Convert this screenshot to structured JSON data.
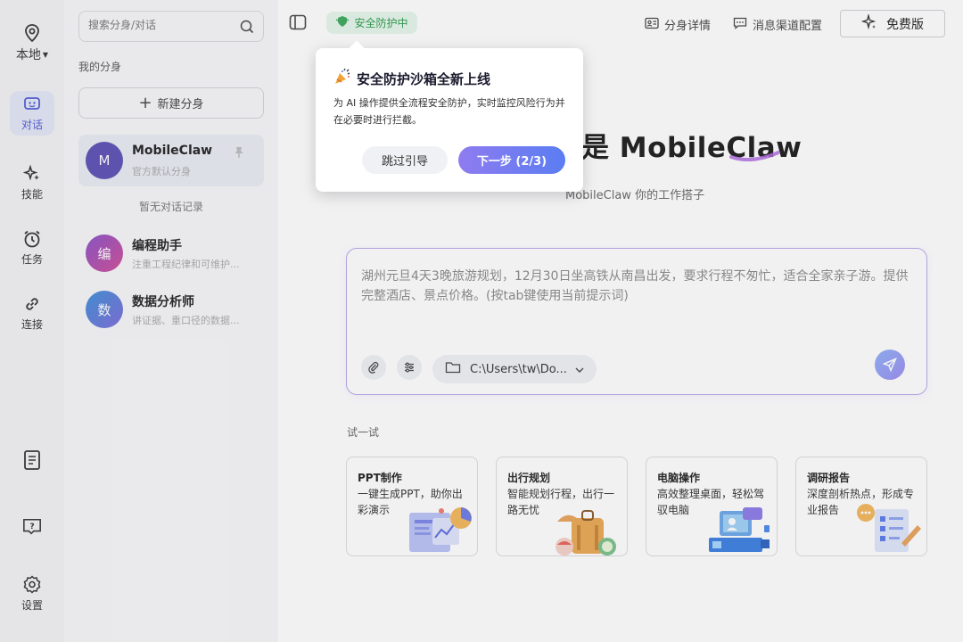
{
  "rail": {
    "location": "本地",
    "items": [
      {
        "label": "对话"
      },
      {
        "label": "技能"
      },
      {
        "label": "任务"
      },
      {
        "label": "连接"
      }
    ],
    "settings": "设置"
  },
  "panel": {
    "search_placeholder": "搜索分身/对话",
    "section_label": "我的分身",
    "new_button": "新建分身",
    "clones": [
      {
        "initial": "M",
        "name": "MobileClaw",
        "desc": "官方默认分身",
        "color": "#5b4fb3"
      },
      {
        "initial": "编",
        "name": "编程助手",
        "desc": "注重工程纪律和可维护...",
        "color": "#b44ea9"
      },
      {
        "initial": "数",
        "name": "数据分析师",
        "desc": "讲证据、重口径的数据...",
        "color": "#4a7fd0"
      }
    ],
    "empty_note": "暂无对话记录"
  },
  "header": {
    "security_badge": "安全防护中",
    "clone_details": "分身详情",
    "channel_config": "消息渠道配置",
    "plan": "免费版"
  },
  "hero": {
    "title": "是 MobileClaw",
    "subtitle": "MobileClaw 你的工作搭子"
  },
  "composer": {
    "placeholder": "湖州元旦4天3晚旅游规划，12月30日坐高铁从南昌出发，要求行程不匆忙，适合全家亲子游。提供完整酒店、景点价格。(按tab键使用当前提示词)",
    "path": "C:\\Users\\tw\\Do..."
  },
  "suggestions": {
    "label": "试一试",
    "cards": [
      {
        "title": "PPT制作",
        "desc": "一键生成PPT，助你出彩演示"
      },
      {
        "title": "出行规划",
        "desc": "智能规划行程，出行一路无忧"
      },
      {
        "title": "电脑操作",
        "desc": "高效整理桌面，轻松驾驭电脑"
      },
      {
        "title": "调研报告",
        "desc": "深度剖析热点，形成专业报告"
      }
    ]
  },
  "tooltip": {
    "title": "安全防护沙箱全新上线",
    "desc": "为 AI 操作提供全流程安全防护，实时监控风险行为并在必要时进行拦截。",
    "skip": "跳过引导",
    "next": "下一步 (2/3)"
  },
  "colors": {
    "accent": "#4f5bd5",
    "security_green": "#2a9a4a",
    "composer_border": "#b9a6e8"
  }
}
